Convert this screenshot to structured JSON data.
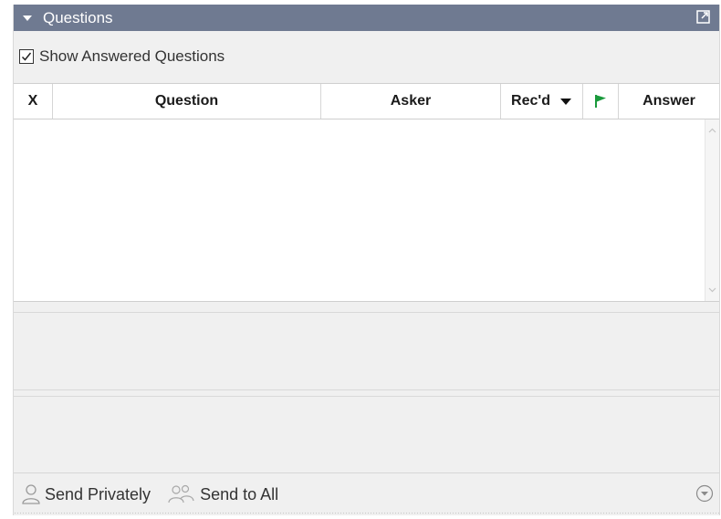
{
  "panel": {
    "title": "Questions"
  },
  "options": {
    "show_answered_label": "Show Answered Questions",
    "show_answered_checked": true
  },
  "grid": {
    "columns": [
      {
        "key": "x",
        "label": "X"
      },
      {
        "key": "question",
        "label": "Question"
      },
      {
        "key": "asker",
        "label": "Asker"
      },
      {
        "key": "recd",
        "label": "Rec'd"
      },
      {
        "key": "flag",
        "label": ""
      },
      {
        "key": "answer",
        "label": "Answer"
      }
    ],
    "rows": []
  },
  "footer": {
    "send_privately": "Send Privately",
    "send_to_all": "Send to All"
  },
  "colors": {
    "titlebar": "#6f7a91",
    "flag": "#1a9a3c"
  },
  "icons": {
    "collapse": "triangle-down-icon",
    "popout": "popout-icon",
    "sort": "sort-desc-icon",
    "flag": "flag-icon",
    "person": "person-icon",
    "group": "group-icon",
    "more": "more-options-icon"
  }
}
